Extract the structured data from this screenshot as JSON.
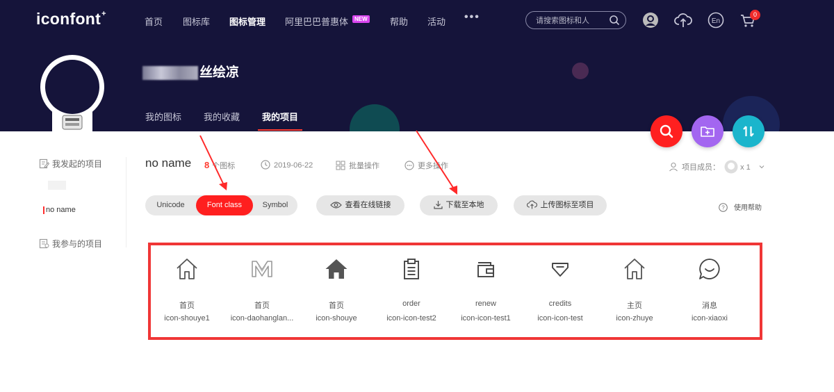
{
  "nav": {
    "logo": "iconfont",
    "logo_mark": "+",
    "items": [
      "首页",
      "图标库",
      "图标管理",
      "阿里巴巴普惠体",
      "帮助",
      "活动"
    ],
    "new_badge": "NEW",
    "more": "•••",
    "search_placeholder": "请搜索图标和人",
    "cart_count": "0",
    "lang": "En"
  },
  "profile": {
    "username_visible": "丝绘凉",
    "tabs": [
      "我的图标",
      "我的收藏",
      "我的项目"
    ],
    "active_tab": "我的项目"
  },
  "sidebar": {
    "my_projects": "我发起的项目",
    "active_project": "no name",
    "joined_projects": "我参与的项目"
  },
  "project": {
    "name": "no name",
    "icon_count": "8",
    "icon_count_label": "个图标",
    "date": "2019-06-22",
    "batch": "批量操作",
    "more_ops": "更多操作",
    "members_label": "项目成员：",
    "members_count": "x 1"
  },
  "toolbar": {
    "modes": [
      "Unicode",
      "Font class",
      "Symbol"
    ],
    "selected_mode": "Font class",
    "view_link": "查看在线链接",
    "download": "下载至本地",
    "upload": "上传图标至项目",
    "help": "使用帮助"
  },
  "icons": [
    {
      "name": "首页",
      "class": "icon-shouye1",
      "icon": "house-outline-icon"
    },
    {
      "name": "首页",
      "class": "icon-daohanglan...",
      "icon": "m-logo-icon"
    },
    {
      "name": "首页",
      "class": "icon-shouye",
      "icon": "house-filled-icon"
    },
    {
      "name": "order",
      "class": "icon-icon-test2",
      "icon": "clipboard-icon"
    },
    {
      "name": "renew",
      "class": "icon-icon-test1",
      "icon": "wallet-icon"
    },
    {
      "name": "credits",
      "class": "icon-icon-test",
      "icon": "gem-icon"
    },
    {
      "name": "主页",
      "class": "icon-zhuye",
      "icon": "house-outline-icon"
    },
    {
      "name": "消息",
      "class": "icon-xiaoxi",
      "icon": "chat-bubble-icon"
    }
  ],
  "colors": {
    "banner": "#15143a",
    "accent_red": "#ff1f1f",
    "fab_search": "#ff2020",
    "fab_add_folder": "#a366f0",
    "fab_sort": "#1bb5cc",
    "grid_border": "#f03636"
  }
}
